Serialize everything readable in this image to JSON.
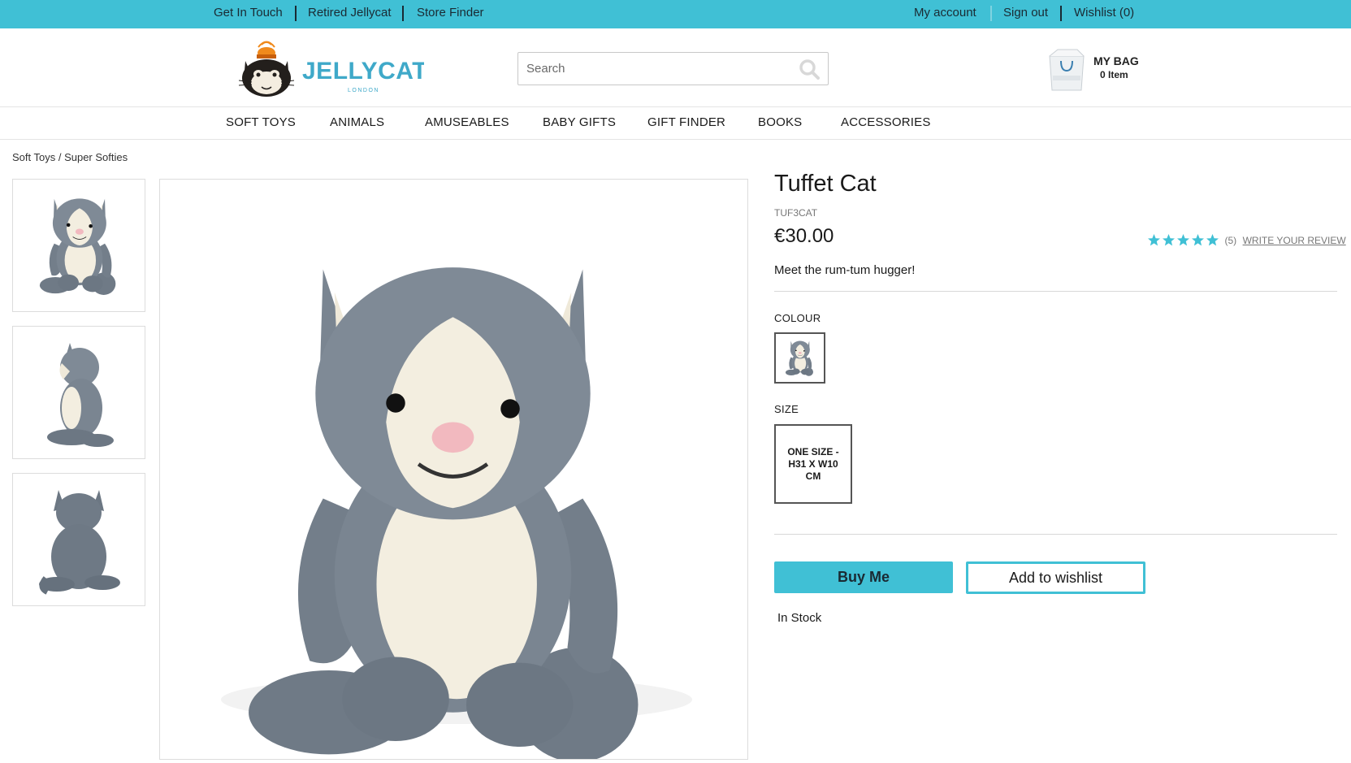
{
  "colors": {
    "accent": "#40c0d5",
    "text": "#1a1a1a",
    "border": "#dcdcdc",
    "logo_blue": "#3fa9c9",
    "logo_orange": "#f08a1c"
  },
  "topbar": {
    "left_links": [
      "Get In Touch",
      "Retired Jellycat",
      "Store Finder"
    ],
    "right_links": [
      "My account",
      "Sign out",
      "Wishlist (0)"
    ]
  },
  "header": {
    "logo": {
      "brand": "JELLYCAT",
      "sub": "LONDON",
      "icon": "cat-logo-icon"
    },
    "search": {
      "placeholder": "Search",
      "icon": "search-icon"
    },
    "bag": {
      "title": "MY BAG",
      "count": "0 Item",
      "icon": "shopping-bag-icon"
    }
  },
  "nav": {
    "items": [
      "SOFT TOYS",
      "ANIMALS",
      "AMUSEABLES",
      "BABY GIFTS",
      "GIFT FINDER",
      "BOOKS",
      "ACCESSORIES"
    ]
  },
  "breadcrumb": "Soft Toys / Super Softies",
  "gallery": {
    "thumbnails": [
      "front-view",
      "side-view",
      "back-view"
    ],
    "main": "front-view"
  },
  "product": {
    "title": "Tuffet Cat",
    "sku": "TUF3CAT",
    "price": "€30.00",
    "rating": {
      "stars": 5,
      "max": 5,
      "count": "(5)",
      "review_link": "WRITE YOUR REVIEW"
    },
    "tagline": "Meet the rum-tum hugger!",
    "colour_label": "COLOUR",
    "size_label": "SIZE",
    "size_option": "ONE SIZE - H31 X W10 CM",
    "buy_label": "Buy Me",
    "wishlist_label": "Add to wishlist",
    "stock": "In Stock"
  }
}
